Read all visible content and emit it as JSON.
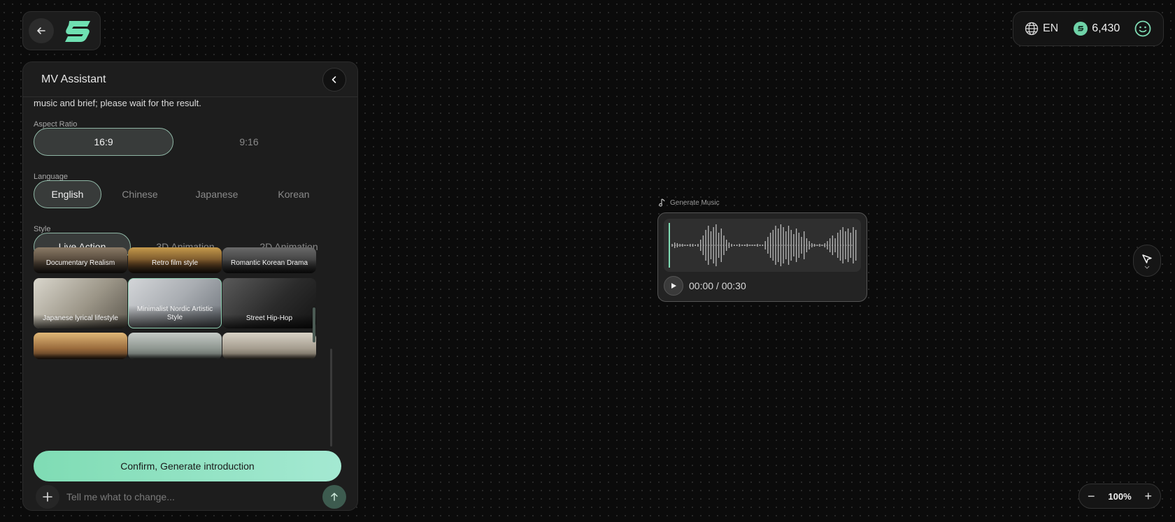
{
  "header": {
    "language_code": "EN",
    "credits": "6,430"
  },
  "panel": {
    "title": "MV Assistant",
    "intro_text": "music and brief; please wait for the result.",
    "aspect_ratio": {
      "label": "Aspect Ratio",
      "options": [
        "16:9",
        "9:16"
      ],
      "selected": "16:9"
    },
    "language": {
      "label": "Language",
      "options": [
        "English",
        "Chinese",
        "Japanese",
        "Korean"
      ],
      "selected": "English"
    },
    "style": {
      "label": "Style",
      "options": [
        "Live Action",
        "3D Animation",
        "2D Animation"
      ],
      "selected": "Live Action",
      "presets": [
        {
          "label": "Documentary Realism"
        },
        {
          "label": "Retro film style"
        },
        {
          "label": "Romantic Korean Drama"
        },
        {
          "label": "Japanese lyrical lifestyle"
        },
        {
          "label": "Minimalist Nordic Artistic Style",
          "selected": true
        },
        {
          "label": "Street Hip-Hop"
        },
        {
          "label": ""
        },
        {
          "label": ""
        },
        {
          "label": ""
        }
      ]
    },
    "confirm_label": "Confirm, Generate introduction",
    "input_placeholder": "Tell me what to change..."
  },
  "music_node": {
    "label": "Generate Music",
    "time": "00:00 / 00:30",
    "progress": 0
  },
  "zoom": {
    "level": "100%",
    "minus": "−",
    "plus": "+"
  },
  "colors": {
    "accent": "#7fdcb4",
    "background": "#0b0b0b",
    "panel": "#1d1d1d"
  }
}
